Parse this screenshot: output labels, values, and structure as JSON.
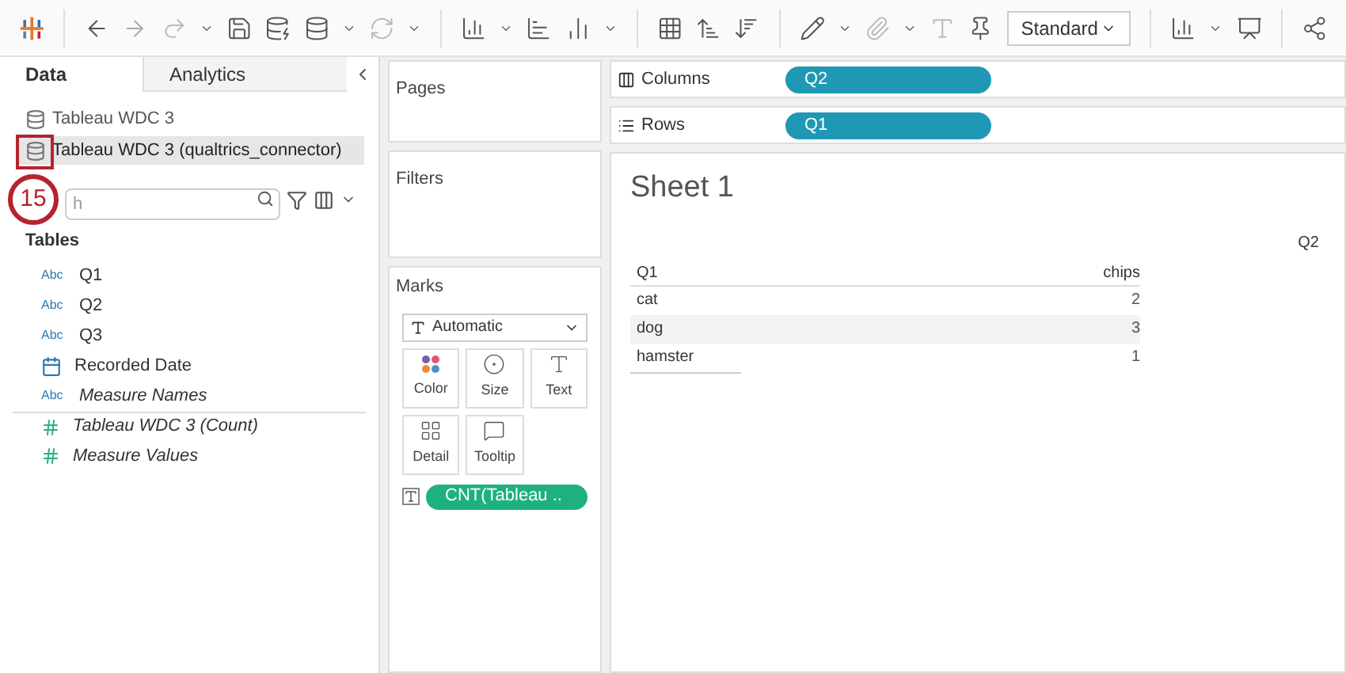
{
  "toolbar": {
    "mark_type": "Standard"
  },
  "data_pane": {
    "tabs": [
      {
        "label": "Data",
        "selected": true
      },
      {
        "label": "Analytics",
        "selected": false
      }
    ],
    "sources": [
      {
        "name": "Tableau WDC 3",
        "selected": false
      },
      {
        "name": "Tableau WDC 3 (qualtrics_connector)",
        "selected": true
      }
    ],
    "callout": "15",
    "search": {
      "placeholder": "h"
    },
    "section": "Tables",
    "fields": [
      {
        "kind": "dimension",
        "type_label": "Abc",
        "name": "Q1",
        "italic": false
      },
      {
        "kind": "dimension",
        "type_label": "Abc",
        "name": "Q2",
        "italic": false
      },
      {
        "kind": "dimension",
        "type_label": "Abc",
        "name": "Q3",
        "italic": false
      },
      {
        "kind": "date",
        "name": "Recorded Date",
        "italic": false
      },
      {
        "kind": "dimension",
        "type_label": "Abc",
        "name": "Measure Names",
        "italic": true
      },
      {
        "kind": "measure",
        "name": "Tableau WDC 3 (Count)",
        "italic": true
      },
      {
        "kind": "measure",
        "name": "Measure Values",
        "italic": true
      }
    ]
  },
  "cards": {
    "pages": "Pages",
    "filters": "Filters",
    "marks": {
      "title": "Marks",
      "type": "Automatic",
      "buttons": [
        {
          "kind": "color",
          "label": "Color"
        },
        {
          "kind": "size",
          "label": "Size"
        },
        {
          "kind": "text",
          "label": "Text"
        },
        {
          "kind": "detail",
          "label": "Detail"
        },
        {
          "kind": "tooltip",
          "label": "Tooltip"
        }
      ],
      "pill": "CNT(Tableau .."
    }
  },
  "shelves": [
    {
      "kind": "columns",
      "label": "Columns",
      "pill": "Q2"
    },
    {
      "kind": "rows",
      "label": "Rows",
      "pill": "Q1"
    }
  ],
  "sheet": {
    "title": "Sheet 1",
    "column_header": "Q2",
    "row_header": "Q1",
    "column_value": "chips",
    "rows": [
      {
        "label": "cat",
        "value": "2"
      },
      {
        "label": "dog",
        "value": "3"
      },
      {
        "label": "hamster",
        "value": "1"
      }
    ]
  }
}
